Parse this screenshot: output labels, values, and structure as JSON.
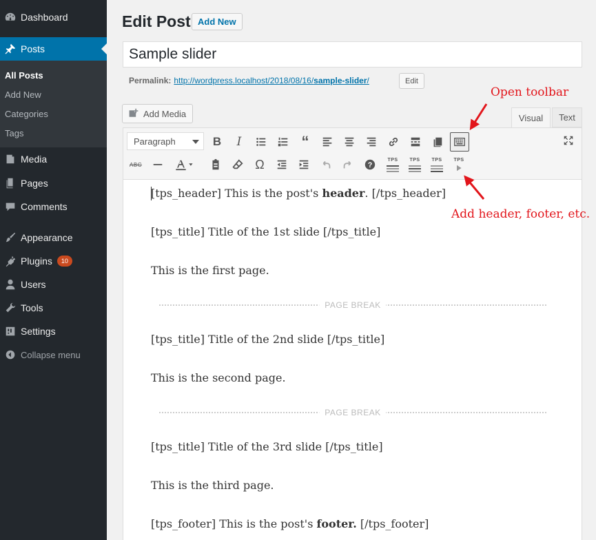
{
  "sidebar": {
    "dashboard": "Dashboard",
    "posts": "Posts",
    "submenu": [
      "All Posts",
      "Add New",
      "Categories",
      "Tags"
    ],
    "media": "Media",
    "pages": "Pages",
    "comments": "Comments",
    "appearance": "Appearance",
    "plugins": "Plugins",
    "plugins_badge": "10",
    "users": "Users",
    "tools": "Tools",
    "settings": "Settings",
    "collapse": "Collapse menu"
  },
  "header": {
    "title": "Edit Post",
    "add_new": "Add New"
  },
  "post": {
    "title": "Sample slider",
    "permalink_label": "Permalink:",
    "permalink_base": "http://wordpress.localhost/2018/08/16/",
    "permalink_slug": "sample-slider",
    "permalink_tail": "/",
    "edit_label": "Edit"
  },
  "editor": {
    "add_media": "Add Media",
    "tab_visual": "Visual",
    "tab_text": "Text",
    "format_select": "Paragraph",
    "tps_label": "TPS",
    "content": {
      "line1_pre": "[tps_header] This is the post's ",
      "line1_bold": "header",
      "line1_post": ". [/tps_header]",
      "line2": "[tps_title] Title of the 1st slide [/tps_title]",
      "line3": "This is the first page.",
      "pagebreak": "PAGE BREAK",
      "line4": "[tps_title] Title of the 2nd slide [/tps_title]",
      "line5": "This is the second page.",
      "line6": "[tps_title] Title of the 3rd slide [/tps_title]",
      "line7": "This is the third page.",
      "line8_pre": "[tps_footer] This is the post's ",
      "line8_bold": "footer.",
      "line8_post": " [/tps_footer]"
    }
  },
  "annotations": {
    "open_toolbar": "Open toolbar",
    "add_header": "Add header, footer, etc."
  },
  "colors": {
    "sidebar_bg": "#23282d",
    "active_bg": "#0073aa",
    "annotation": "#e2151b",
    "badge": "#ca4a1f"
  }
}
